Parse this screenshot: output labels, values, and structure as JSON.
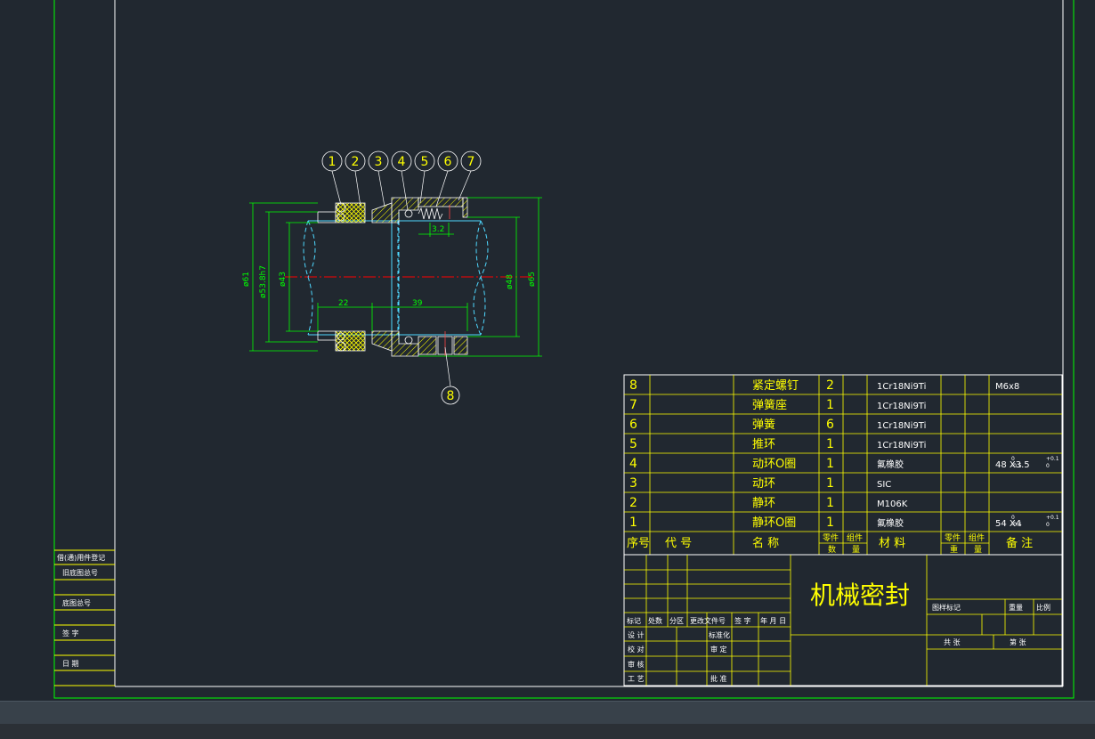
{
  "drawing": {
    "title": "机械密封",
    "balloons": [
      "1",
      "2",
      "3",
      "4",
      "5",
      "6",
      "7",
      "8"
    ],
    "dimensions": {
      "d61": "ø61",
      "d53": "ø53.8h7",
      "d43": "ø43",
      "d48": "ø48",
      "d65": "ø65",
      "l22": "22",
      "l39": "39",
      "l32": "3.2"
    }
  },
  "parts_list": {
    "header": {
      "no": "序号",
      "code": "代  号",
      "name": "名  称",
      "qty_top": "零件",
      "qty_bottom": "数",
      "qty_top2": "组件",
      "qty_bottom2": "量",
      "material": "材  料",
      "wt_top": "零件",
      "wt_bottom": "重",
      "wt_top2": "组件",
      "wt_bottom2": "量",
      "remark": "备  注"
    },
    "rows": [
      {
        "no": "8",
        "name": "紧定螺钉",
        "qty": "2",
        "material": "1Cr18Ni9Ti",
        "remark": "M6x8"
      },
      {
        "no": "7",
        "name": "弹簧座",
        "qty": "1",
        "material": "1Cr18Ni9Ti",
        "remark": ""
      },
      {
        "no": "6",
        "name": "弹簧",
        "qty": "6",
        "material": "1Cr18Ni9Ti",
        "remark": ""
      },
      {
        "no": "5",
        "name": "推环",
        "qty": "1",
        "material": "1Cr18Ni9Ti",
        "remark": ""
      },
      {
        "no": "4",
        "name": "动环O圈",
        "qty": "1",
        "material": "氟橡胶",
        "remark": "48 X3.5"
      },
      {
        "no": "3",
        "name": "动环",
        "qty": "1",
        "material": "SIC",
        "remark": ""
      },
      {
        "no": "2",
        "name": "静环",
        "qty": "1",
        "material": "M106K",
        "remark": ""
      },
      {
        "no": "1",
        "name": "静环O圈",
        "qty": "1",
        "material": "氟橡胶",
        "remark": "54 X4"
      }
    ]
  },
  "title_block": {
    "labels": {
      "mark": "标记",
      "count": "处数",
      "zone": "分区",
      "change_doc": "更改文件号",
      "sign": "签 字",
      "date": "年 月 日",
      "design": "设 计",
      "check": "校 对",
      "review": "审 核",
      "process": "工 艺",
      "standard": "标准化",
      "approve_review": "审 定",
      "approve": "批 准",
      "stage": "图样标记",
      "weight": "重量",
      "scale": "比例",
      "total": "共    张",
      "sheet": "第    张"
    }
  },
  "side_block": {
    "labels": [
      "借(通)用件登记",
      "旧底图总号",
      "底图总号",
      "签  字",
      "日  期"
    ]
  }
}
